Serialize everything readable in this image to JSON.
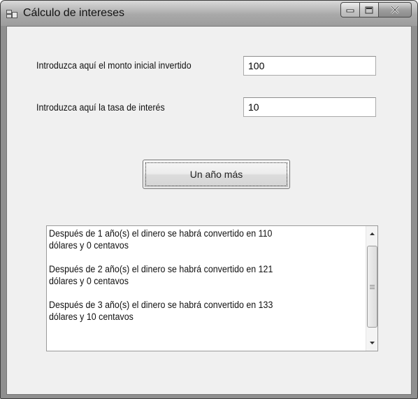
{
  "window": {
    "title": "Cálculo de intereses",
    "icons": {
      "app": "form-icon",
      "minimize": "minimize-icon",
      "maximize": "maximize-icon",
      "close": "close-icon"
    }
  },
  "form": {
    "monto_label": "Introduzca aquí el monto inicial invertido",
    "monto_value": "100",
    "tasa_label": "Introduzca aquí la tasa de interés",
    "tasa_value": "10",
    "button_label": "Un año más"
  },
  "results": {
    "items": [
      "Después de 1 año(s) el dinero se habrá convertido en 110",
      "dólares y 0 centavos",
      "",
      "Después de 2 año(s) el dinero se habrá convertido en 121",
      "dólares y 0 centavos",
      "",
      "Después de 3 año(s) el dinero se habrá convertido en 133",
      "dólares y 10 centavos"
    ],
    "scrollbar": {
      "up_icon": "scroll-up-arrow-icon",
      "down_icon": "scroll-down-arrow-icon",
      "grip_icon": "scroll-grip-icon"
    }
  },
  "colors": {
    "titlebar": "#a9a9a9",
    "client_background": "#f0f0f0",
    "window_frame": "#8f8f8f"
  }
}
